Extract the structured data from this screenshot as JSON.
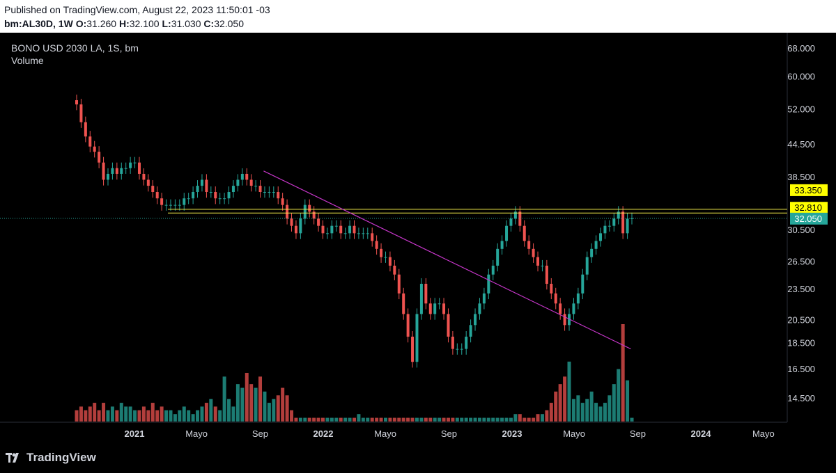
{
  "header": {
    "published": "Published on TradingView.com, August 22, 2023 11:50:01 -03",
    "symbol": "bm:AL30D, 1W",
    "ohlc": {
      "o_label": "O:",
      "o": "31.260",
      "h_label": "H:",
      "h": "32.100",
      "l_label": "L:",
      "l": "31.030",
      "c_label": "C:",
      "c": "32.050"
    }
  },
  "legend": {
    "title": "BONO USD 2030 LA, 1S, bm",
    "volume_label": "Volume"
  },
  "brand": {
    "name": "TradingView"
  },
  "colors": {
    "up": "#26a69a",
    "down": "#ef5350",
    "trendline": "#c636c9",
    "hline": "#f5f04a",
    "label_bg": "#ffff00",
    "last_bg": "#26a69a",
    "axis_text": "#d1d4dc"
  },
  "chart_data": {
    "type": "candlestick",
    "y_scale": "log",
    "price_axis_ticks": [
      "68.000",
      "60.000",
      "52.000",
      "44.500",
      "38.500",
      "30.500",
      "26.500",
      "23.500",
      "20.500",
      "18.500",
      "16.500",
      "14.500"
    ],
    "time_axis_ticks": [
      "2021",
      "Mayo",
      "Sep",
      "2022",
      "Mayo",
      "Sep",
      "2023",
      "Mayo",
      "Sep",
      "2024",
      "Mayo"
    ],
    "horizontal_levels": [
      {
        "price": "33.350",
        "value": 33.35
      },
      {
        "price": "32.810",
        "value": 32.81
      }
    ],
    "last_price": {
      "label": "32.050",
      "value": 32.05
    },
    "trendline": {
      "start": [
        "2021-09",
        39.5
      ],
      "end": [
        "2023-09",
        18.0
      ]
    },
    "price_path_weekly_close": [
      53,
      49,
      46,
      44,
      43,
      41,
      38,
      39,
      40,
      39,
      40,
      40,
      41,
      41,
      39,
      38,
      37,
      36,
      35,
      34,
      34,
      34,
      34,
      34,
      35,
      35,
      36,
      37,
      38,
      36,
      36,
      35,
      35,
      35,
      36,
      37,
      38,
      39,
      38,
      37,
      37,
      36,
      36,
      36,
      36,
      35,
      34,
      32,
      31,
      30,
      32,
      34,
      33,
      32,
      31,
      30,
      30,
      31,
      31,
      30,
      30,
      31,
      30,
      30,
      30,
      30,
      29,
      28,
      27,
      27,
      26,
      25,
      23,
      21,
      19,
      17,
      21,
      24,
      22,
      21,
      22,
      22,
      21,
      19,
      18,
      18,
      18,
      19,
      20,
      21,
      22,
      23,
      25,
      26,
      28,
      29,
      31,
      32,
      33,
      31,
      29,
      28,
      27,
      26,
      26,
      24,
      23,
      22,
      21,
      20,
      21,
      22,
      23,
      25,
      27,
      28,
      29,
      30,
      31,
      31,
      32,
      33,
      30,
      32,
      32.05
    ],
    "volume_bars": [
      3,
      4,
      3,
      4,
      5,
      3,
      5,
      3,
      4,
      3,
      5,
      4,
      4,
      3,
      3,
      4,
      3,
      5,
      3,
      4,
      3,
      3,
      2,
      3,
      4,
      3,
      2,
      3,
      4,
      5,
      6,
      4,
      3,
      12,
      6,
      4,
      10,
      9,
      13,
      10,
      9,
      12,
      8,
      5,
      6,
      7,
      9,
      7,
      3,
      1,
      1,
      1,
      1,
      1,
      1,
      1,
      1,
      1,
      1,
      1,
      1,
      1,
      1,
      2,
      1,
      1,
      1,
      1,
      1,
      1,
      1,
      1,
      1,
      1,
      1,
      1,
      1,
      1,
      1,
      1,
      1,
      1,
      1,
      1,
      1,
      1,
      1,
      1,
      1,
      1,
      1,
      1,
      1,
      1,
      1,
      1,
      1,
      1,
      2,
      2,
      1,
      1,
      1,
      2,
      2,
      3,
      5,
      8,
      10,
      12,
      16,
      6,
      7,
      5,
      6,
      8,
      5,
      4,
      5,
      7,
      10,
      14,
      26,
      11,
      1
    ]
  }
}
